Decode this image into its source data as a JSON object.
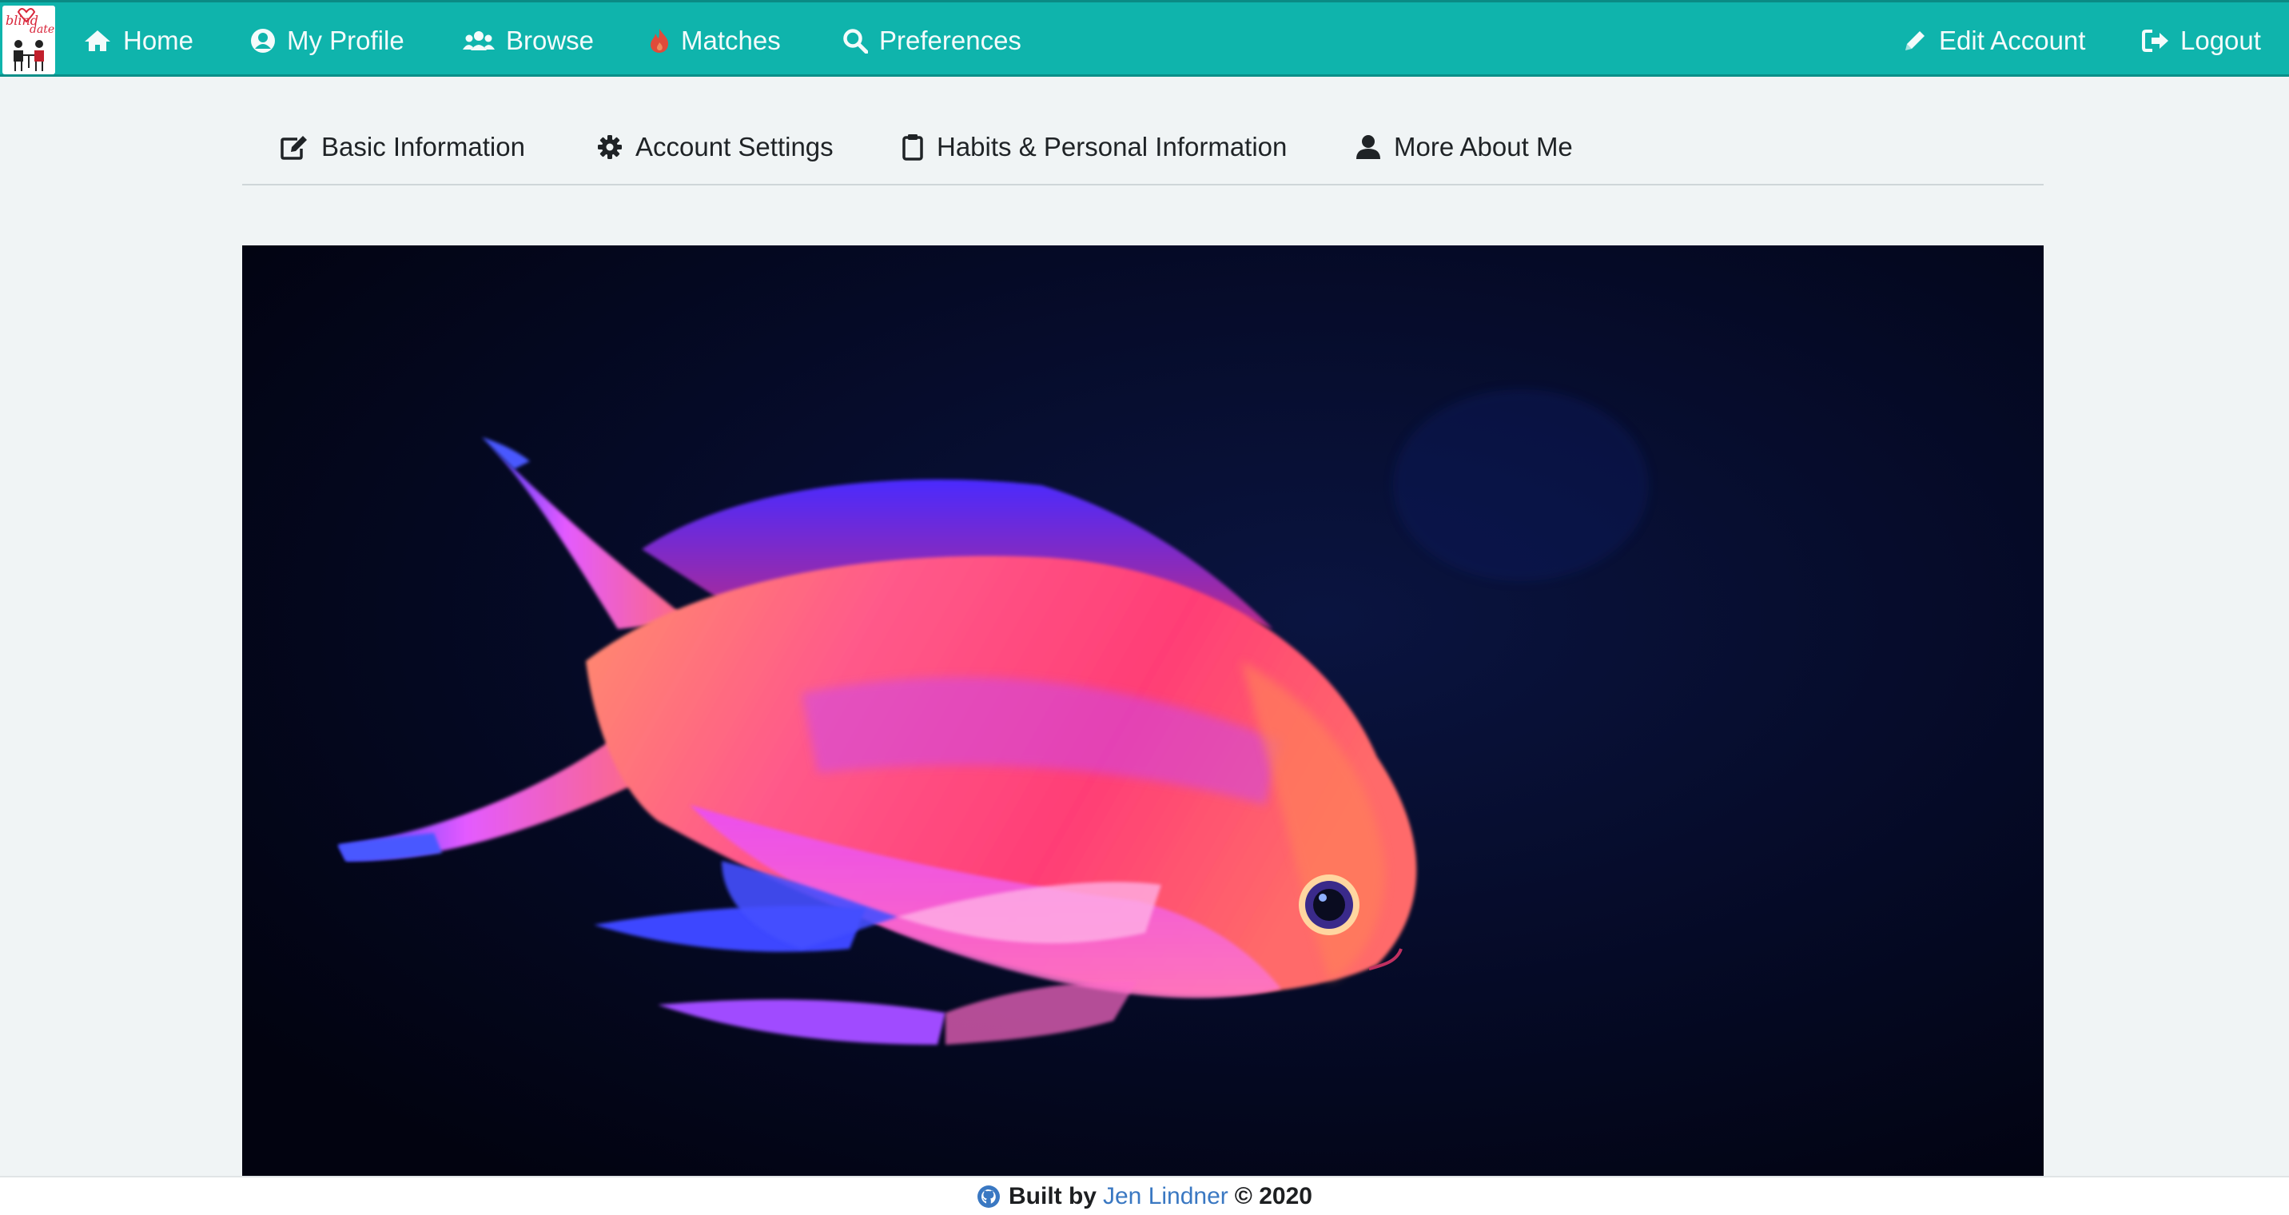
{
  "brand": {
    "name": "blind date",
    "logo_icon": "couple-logo-icon"
  },
  "nav_left": [
    {
      "label": "Home",
      "icon": "home-icon"
    },
    {
      "label": "My Profile",
      "icon": "user-circle-icon"
    },
    {
      "label": "Browse",
      "icon": "users-icon"
    },
    {
      "label": "Matches",
      "icon": "flame-icon",
      "icon_color": "#e04b3a"
    },
    {
      "label": "Preferences",
      "icon": "search-icon"
    }
  ],
  "nav_right": [
    {
      "label": "Edit Account",
      "icon": "pencil-icon"
    },
    {
      "label": "Logout",
      "icon": "sign-out-icon"
    }
  ],
  "tabs": [
    {
      "label": "Basic Information",
      "icon": "edit-icon"
    },
    {
      "label": "Account Settings",
      "icon": "gear-icon"
    },
    {
      "label": "Habits & Personal Information",
      "icon": "clipboard-icon"
    },
    {
      "label": "More About Me",
      "icon": "user-icon"
    }
  ],
  "hero": {
    "description": "fish-photo"
  },
  "footer": {
    "built_by": "Built by",
    "author": "Jen Lindner",
    "copyright": "© 2020",
    "icon": "github-icon"
  },
  "colors": {
    "nav_bg": "#0fb4ac",
    "page_bg": "#f0f4f5",
    "link": "#3a78c2"
  }
}
